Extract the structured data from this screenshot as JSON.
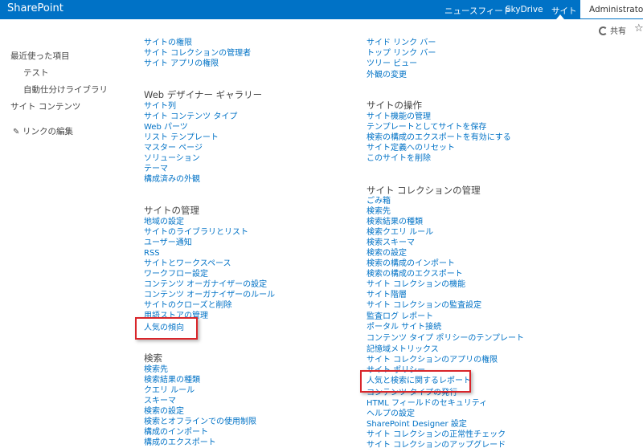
{
  "topbar": {
    "brand": "SharePoint",
    "nav": [
      "ニュースフィード",
      "SkyDrive",
      "サイト"
    ],
    "user": "Administrator"
  },
  "actions": {
    "share_label": "共有"
  },
  "leftnav": {
    "recent": "最近使った項目",
    "recent_items": [
      "テスト",
      "自動仕分けライブラリ"
    ],
    "site_contents": "サイト コンテンツ",
    "edit_links": "リンクの編集"
  },
  "left_column": {
    "top_items": [
      "サイトの権限",
      "サイト コレクションの管理者",
      "サイト アプリの権限"
    ],
    "gallery": {
      "title": "Web デザイナー ギャラリー",
      "items": [
        "サイト列",
        "サイト コンテンツ タイプ",
        "Web パーツ",
        "リスト テンプレート",
        "マスター ページ",
        "ソリューション",
        "テーマ",
        "構成済みの外観"
      ]
    },
    "site_admin": {
      "title": "サイトの管理",
      "items": [
        "地域の設定",
        "サイトのライブラリとリスト",
        "ユーザー通知",
        "RSS",
        "サイトとワークスペース",
        "ワークフロー設定",
        "コンテンツ オーガナイザーの設定",
        "コンテンツ オーガナイザーのルール",
        "サイトのクローズと削除",
        "用語ストアの管理",
        "人気の傾向"
      ]
    },
    "search": {
      "title": "検索",
      "items": [
        "検索先",
        "検索結果の種類",
        "クエリ ルール",
        "スキーマ",
        "検索の設定",
        "検索とオフラインでの使用制限",
        "構成のインポート",
        "構成のエクスポート"
      ]
    }
  },
  "right_column": {
    "top_items": [
      "サイド リンク バー",
      "トップ リンク バー",
      "ツリー ビュー",
      "外観の変更"
    ],
    "site_actions": {
      "title": "サイトの操作",
      "items": [
        "サイト機能の管理",
        "テンプレートとしてサイトを保存",
        "検索の構成のエクスポートを有効にする",
        "サイト定義へのリセット",
        "このサイトを削除"
      ]
    },
    "collection_admin": {
      "title": "サイト コレクションの管理",
      "items": [
        "ごみ箱",
        "検索先",
        "検索結果の種類",
        "検索クエリ ルール",
        "検索スキーマ",
        "検索の設定",
        "検索の構成のインポート",
        "検索の構成のエクスポート",
        "サイト コレクションの機能",
        "サイト階層",
        "サイト コレクションの監査設定",
        "監査ログ レポート",
        "ポータル サイト接続",
        "コンテンツ タイプ ポリシーのテンプレート",
        "記憶域メトリックス",
        "サイト コレクションのアプリの権限",
        "サイト ポリシー",
        "人気と検索に関するレポート",
        "コンテンツ タイプの発行",
        "HTML フィールドのセキュリティ",
        "ヘルプの設定",
        "SharePoint Designer 設定",
        "サイト コレクションの正常性チェック",
        "サイト コレクションのアップグレード"
      ]
    }
  }
}
